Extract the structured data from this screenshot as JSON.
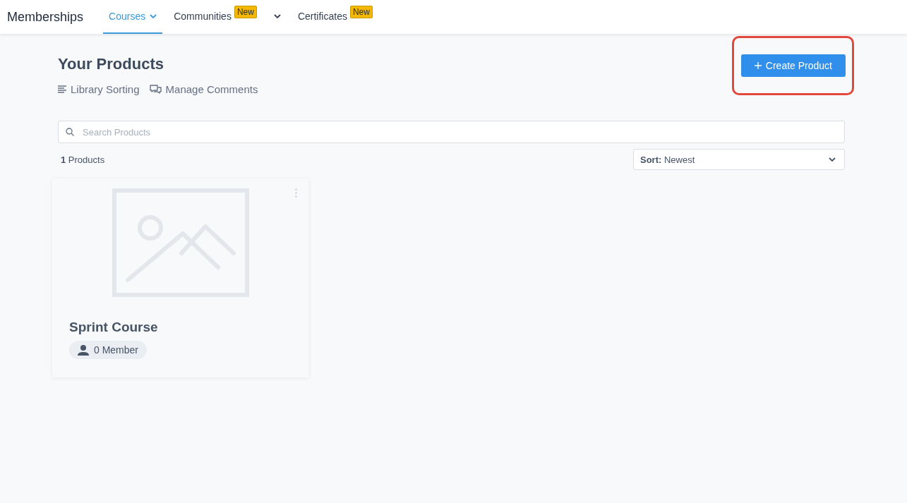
{
  "app_title": "Memberships",
  "tabs": [
    {
      "label": "Courses",
      "selected": true,
      "has_dropdown": true
    },
    {
      "label": "Communities",
      "selected": false,
      "has_dropdown": false,
      "badge": "New"
    },
    {
      "selected": false,
      "has_dropdown": true
    },
    {
      "label": "Certificates",
      "selected": false,
      "has_dropdown": false,
      "badge": "New"
    }
  ],
  "heading": "Your Products",
  "actions": [
    {
      "kind": "sorting",
      "label": "Library Sorting"
    },
    {
      "kind": "comments",
      "label": "Manage Comments"
    }
  ],
  "create_button": {
    "label": "Create Product",
    "highlighted": true
  },
  "search": {
    "placeholder": "Search Products"
  },
  "count": {
    "number": "1",
    "label": "Products"
  },
  "sort": {
    "label": "Sort:",
    "value": "Newest"
  },
  "products": [
    {
      "title": "Sprint Course",
      "members": "0 Member"
    }
  ]
}
